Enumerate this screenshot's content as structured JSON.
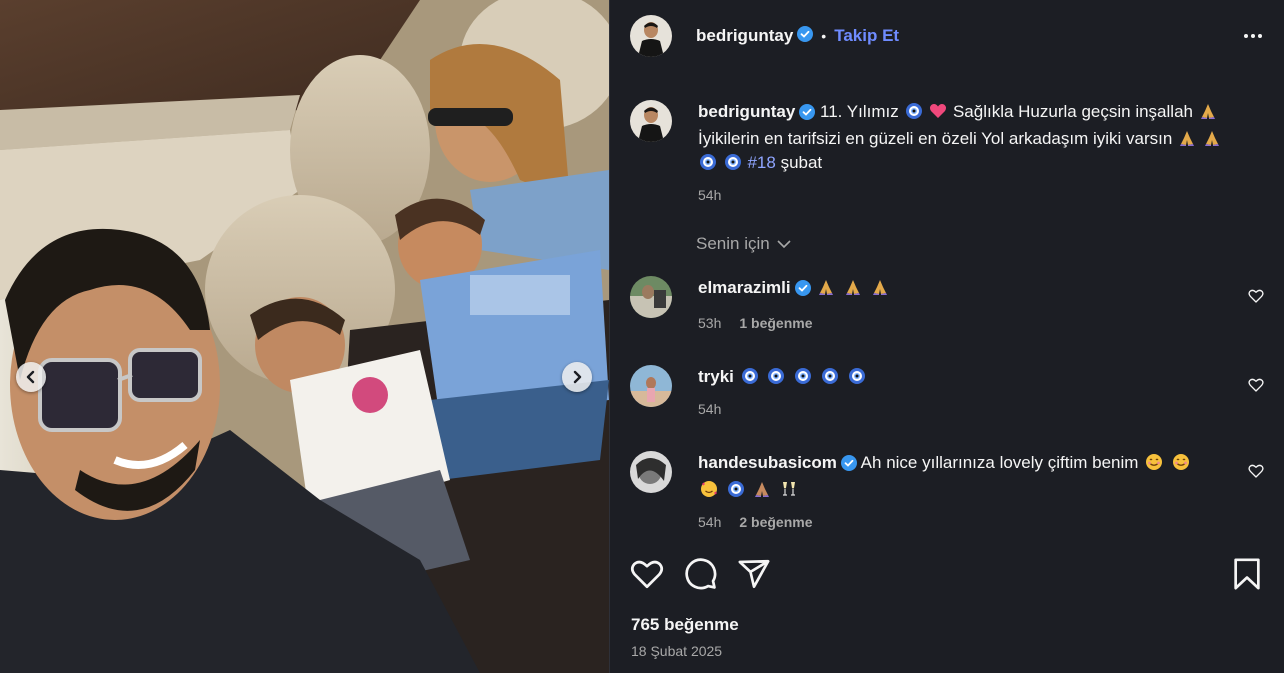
{
  "post": {
    "author": "bedriguntay",
    "follow_label": "Takip Et",
    "dot": "•",
    "caption_user": "bedriguntay",
    "caption_part1": " 11. Yılımız",
    "caption_part2": " Sağlıkla Huzurla geçsin inşallah",
    "caption_part3": " İyikilerin en tarifsizi en güzeli en özeli Yol arkadaşım iyiki varsın",
    "hashtag": "#18",
    "caption_part4": " şubat",
    "time": "54h",
    "for_you": "Senin için",
    "likes": "765 beğenme",
    "date": "18 Şubat 2025"
  },
  "comments": [
    {
      "user": "elmarazimli",
      "text": "",
      "time": "53h",
      "likes": "1 beğenme"
    },
    {
      "user": "tryki",
      "text": "",
      "time": "54h",
      "likes": ""
    },
    {
      "user": "handesubasicom",
      "text": "Ah nice yıllarınıza lovely çiftim benim",
      "time": "54h",
      "likes": "2 beğenme"
    }
  ],
  "colors": {
    "background": "#1c1e24",
    "accent": "#6f8cff",
    "verified": "#3897f0",
    "muted": "#a8a8a8"
  },
  "icons": [
    "verified-icon",
    "more-icon",
    "heart-icon",
    "comment-icon",
    "share-icon",
    "bookmark-icon",
    "chevron-left-icon",
    "chevron-right-icon",
    "chevron-down-icon"
  ]
}
